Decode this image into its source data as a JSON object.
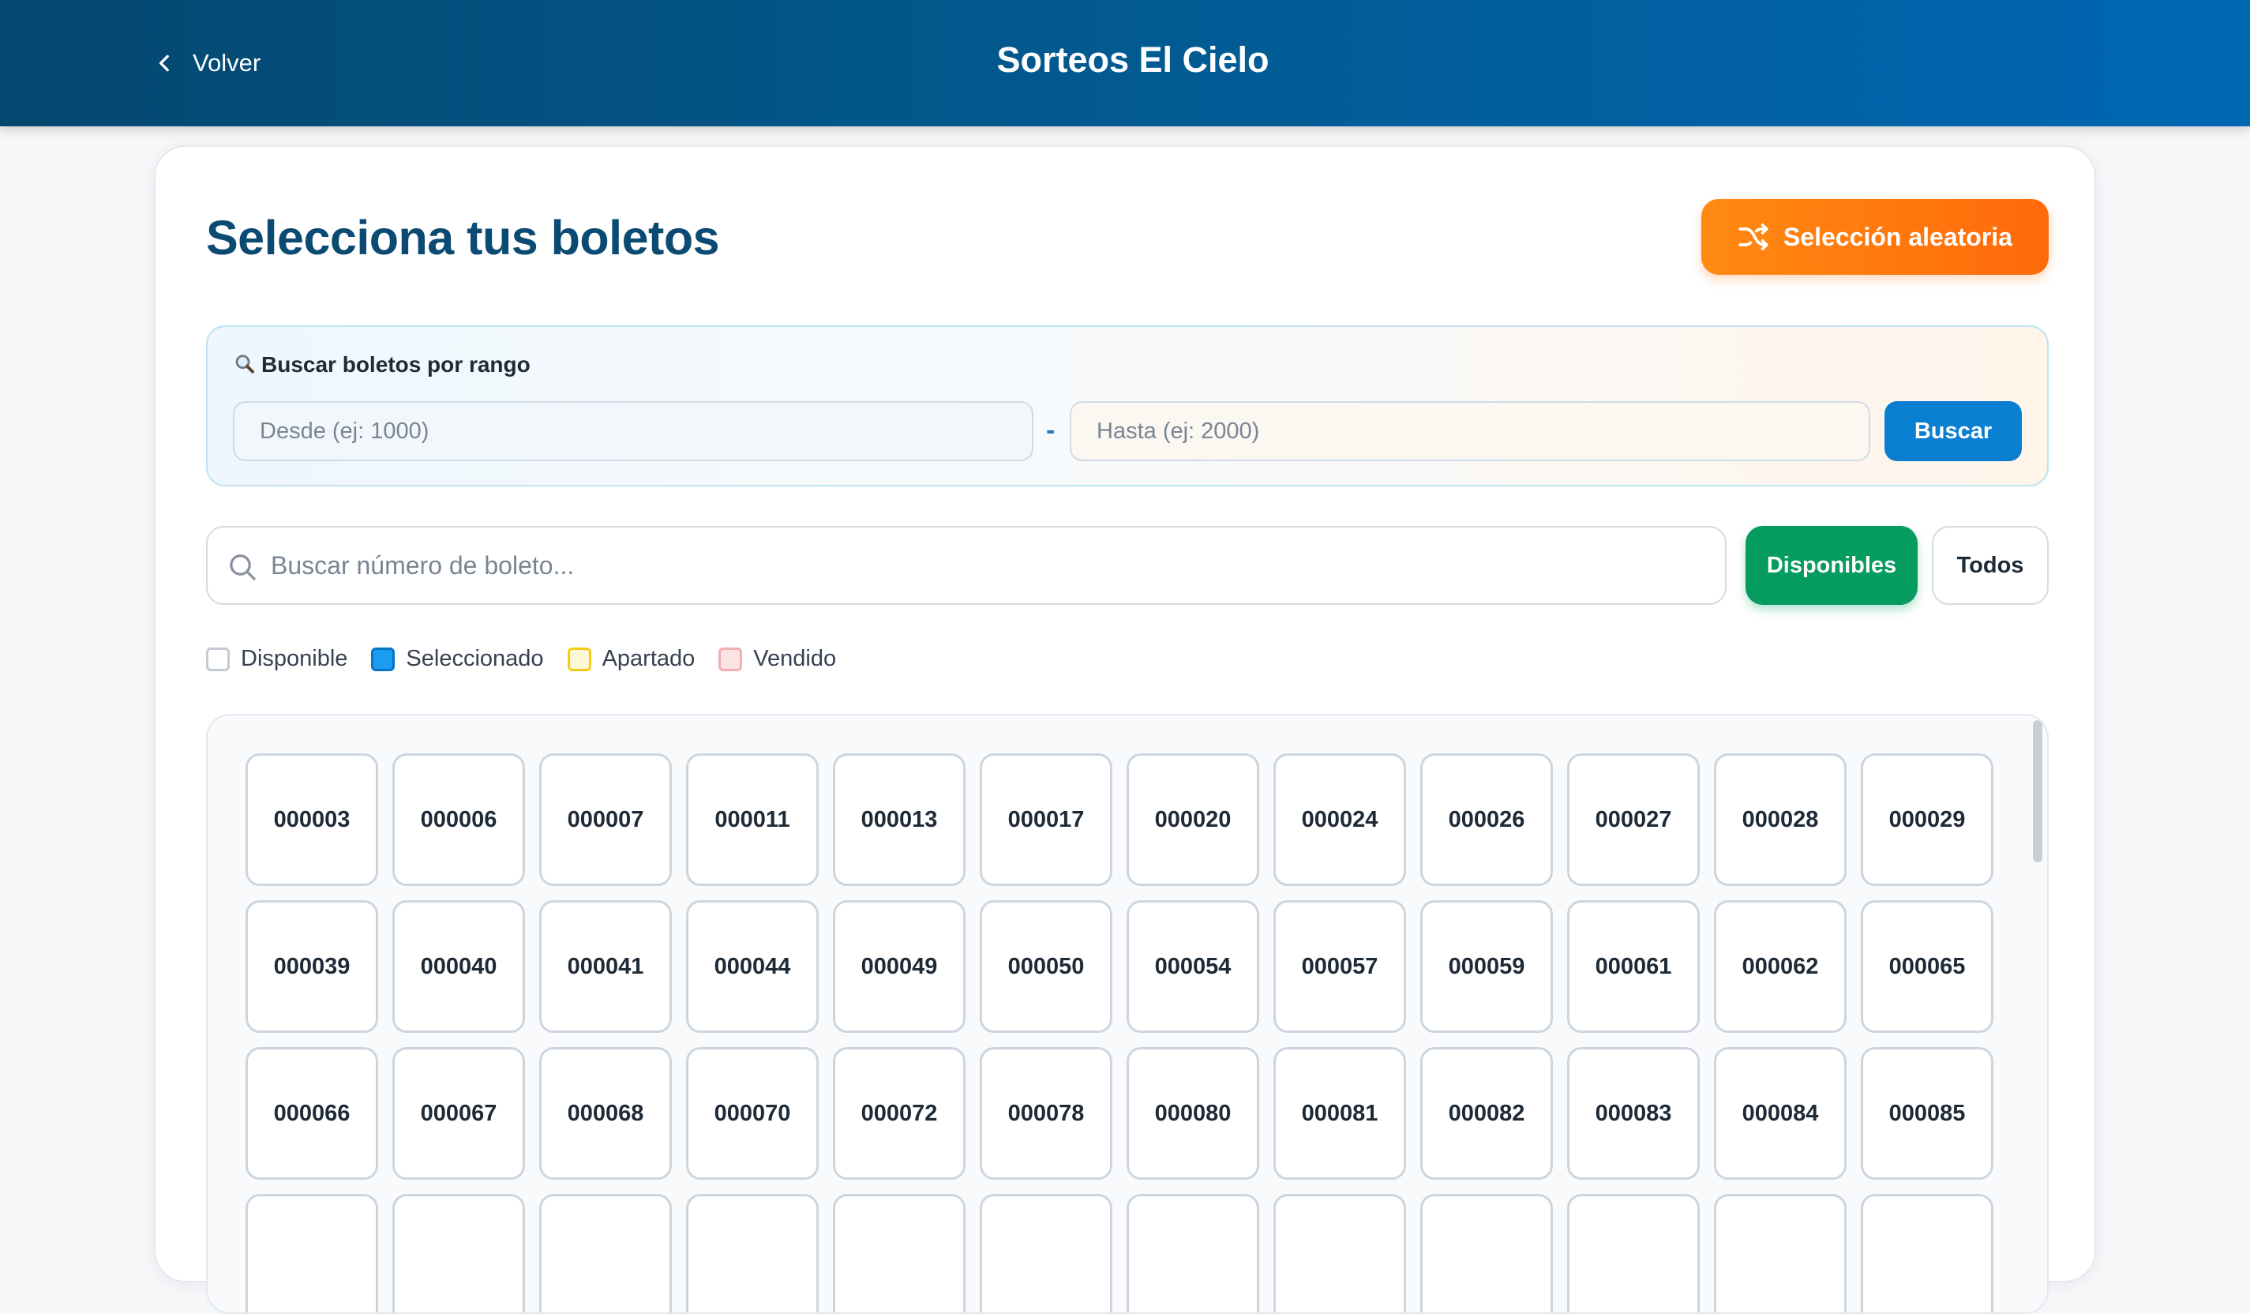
{
  "header": {
    "back_label": "Volver",
    "title": "Sorteos El Cielo"
  },
  "main": {
    "title": "Selecciona tus boletos",
    "random_button_label": "Selección aleatoria"
  },
  "range_search": {
    "label": "Buscar boletos por rango",
    "from_placeholder": "Desde (ej: 1000)",
    "to_placeholder": "Hasta (ej: 2000)",
    "separator": "-",
    "button_label": "Buscar"
  },
  "ticket_search": {
    "placeholder": "Buscar número de boleto...",
    "filters": {
      "available": "Disponibles",
      "all": "Todos"
    }
  },
  "legend": [
    {
      "label": "Disponible",
      "border": "#c4cbd3",
      "fill": "#ffffff"
    },
    {
      "label": "Seleccionado",
      "border": "#0a74c4",
      "fill": "#1a9cf0"
    },
    {
      "label": "Apartado",
      "border": "#f5cc15",
      "fill": "#fff8d6"
    },
    {
      "label": "Vendido",
      "border": "#f2aeb0",
      "fill": "#fde4e4"
    }
  ],
  "tickets": [
    "000003",
    "000006",
    "000007",
    "000011",
    "000013",
    "000017",
    "000020",
    "000024",
    "000026",
    "000027",
    "000028",
    "000029",
    "000039",
    "000040",
    "000041",
    "000044",
    "000049",
    "000050",
    "000054",
    "000057",
    "000059",
    "000061",
    "000062",
    "000065",
    "000066",
    "000067",
    "000068",
    "000070",
    "000072",
    "000078",
    "000080",
    "000081",
    "000082",
    "000083",
    "000084",
    "000085"
  ],
  "partial_row_count": 12,
  "colors": {
    "header_start": "#04486f",
    "header_end": "#0067b3",
    "accent_orange": "#ff7a10",
    "accent_green": "#069c60",
    "accent_blue": "#0a7fd1",
    "title": "#0b4b73"
  },
  "icons": {
    "back": "chevron-left-icon",
    "random": "shuffle-icon",
    "range": "magnifier-icon",
    "search": "search-icon"
  }
}
